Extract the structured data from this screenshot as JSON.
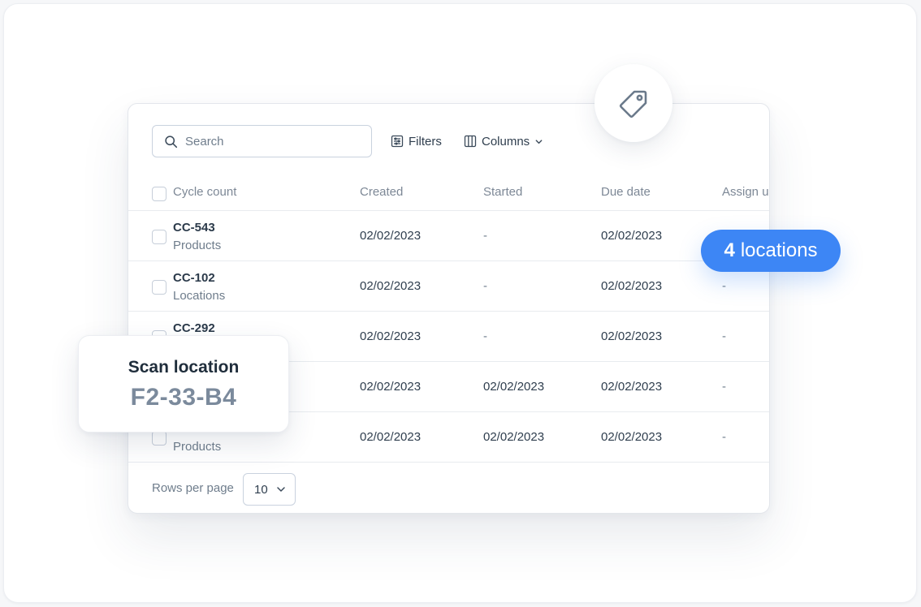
{
  "toolbar": {
    "search_placeholder": "Search",
    "filters_label": "Filters",
    "columns_label": "Columns"
  },
  "table": {
    "headers": {
      "cycle_count": "Cycle count",
      "created": "Created",
      "started": "Started",
      "due_date": "Due date",
      "assign": "Assign u"
    },
    "rows": [
      {
        "id": "CC-543",
        "type": "Products",
        "created": "02/02/2023",
        "started": "-",
        "due": "02/02/2023",
        "assign": ""
      },
      {
        "id": "CC-102",
        "type": "Locations",
        "created": "02/02/2023",
        "started": "-",
        "due": "02/02/2023",
        "assign": "-"
      },
      {
        "id": "CC-292",
        "type": "",
        "created": "02/02/2023",
        "started": "-",
        "due": "02/02/2023",
        "assign": "-"
      },
      {
        "id": "",
        "type": "",
        "created": "02/02/2023",
        "started": "02/02/2023",
        "due": "02/02/2023",
        "assign": "-"
      },
      {
        "id": "",
        "type": "Products",
        "created": "02/02/2023",
        "started": "02/02/2023",
        "due": "02/02/2023",
        "assign": "-"
      }
    ]
  },
  "footer": {
    "rows_per_page_label": "Rows per page",
    "rows_per_page_value": "10"
  },
  "badges": {
    "locations_count": "4",
    "locations_label": "locations"
  },
  "scan_card": {
    "title": "Scan location",
    "value": "F2-33-B4"
  },
  "icons": {
    "search": "search-icon",
    "filters": "filter-list-icon",
    "columns": "columns-icon",
    "chevron": "chevron-down-icon",
    "tag": "tag-icon"
  },
  "colors": {
    "accent": "#3d86f5",
    "text_primary": "#2b3a4a",
    "text_muted": "#6f7d8c",
    "scan_value": "#7b8a9c"
  }
}
